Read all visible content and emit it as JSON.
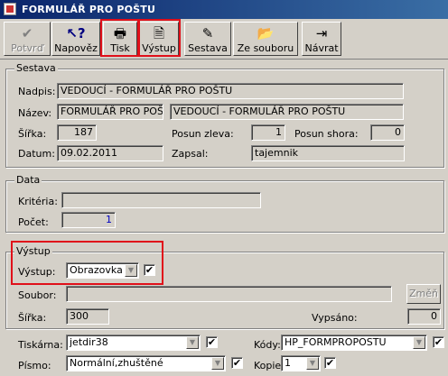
{
  "window": {
    "title": "FORMULÁŘ PRO POŠTU"
  },
  "toolbar": {
    "confirm": "Potvrď",
    "help": "Napověz",
    "print": "Tisk",
    "output": "Výstup",
    "report": "Sestava",
    "from_file": "Ze souboru",
    "return": "Návrat"
  },
  "sestava": {
    "group_label": "Sestava",
    "nadpis_label": "Nadpis:",
    "nadpis_value": "VEDOUCÍ - FORMULÁŘ PRO POŠTU",
    "nazev_label": "Název:",
    "nazev_value1": "FORMULÁŘ PRO POŠ",
    "nazev_value2": "VEDOUCÍ - FORMULÁŘ PRO POŠTU",
    "sirka_label": "Šířka:",
    "sirka_value": "187",
    "posun_zleva_label": "Posun zleva:",
    "posun_zleva_value": "1",
    "posun_shora_label": "Posun shora:",
    "posun_shora_value": "0",
    "datum_label": "Datum:",
    "datum_value": "09.02.2011",
    "zapsal_label": "Zapsal:",
    "zapsal_value": "tajemnik"
  },
  "data": {
    "group_label": "Data",
    "kriteria_label": "Kritéria:",
    "kriteria_value": "",
    "pocet_label": "Počet:",
    "pocet_value": "1"
  },
  "vystup": {
    "group_label": "Výstup",
    "vystup_label": "Výstup:",
    "vystup_value": "Obrazovka",
    "vystup_checked": "✔",
    "soubor_label": "Soubor:",
    "soubor_value": "",
    "zmen_button": "Změň",
    "sirka_label": "Šířka:",
    "sirka_value": "300",
    "vypsano_label": "Vypsáno:",
    "vypsano_value": "0",
    "tiskarna_label": "Tiskárna:",
    "tiskarna_value": "jetdir38",
    "tiskarna_checked": "✔",
    "kody_label": "Kódy:",
    "kody_value": "HP_FORMPROPOSTU",
    "kody_checked": "✔",
    "pismo_label": "Písmo:",
    "pismo_value": "Normální,zhuštěné",
    "pismo_checked": "✔",
    "kopie_label": "Kopie:",
    "kopie_value": "1",
    "kopie_checked": "✔"
  },
  "colors": {
    "title_bar": "#0a246a",
    "highlight_box": "#e0101a",
    "panel": "#d4d0c8"
  }
}
